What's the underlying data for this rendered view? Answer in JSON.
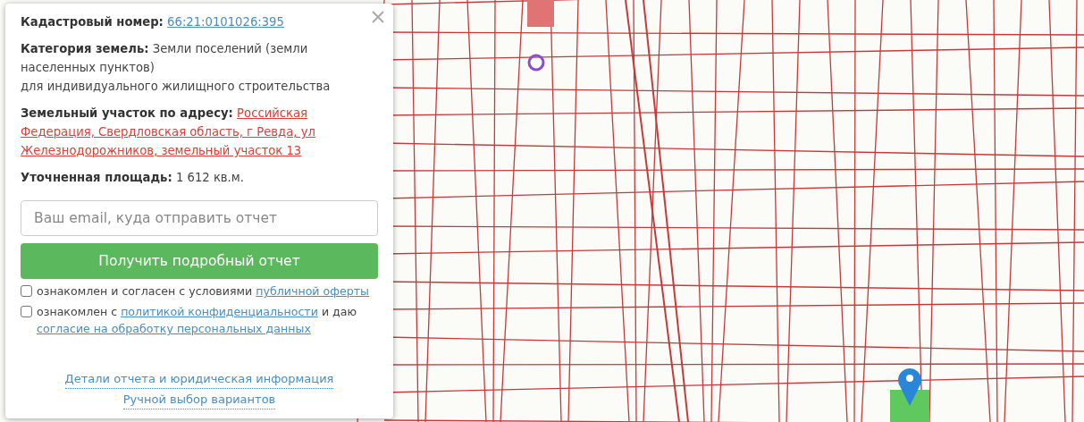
{
  "info_panel": {
    "cadastral": {
      "label": "Кадастровый номер:",
      "value": "66:21:0101026:395"
    },
    "category": {
      "label": "Категория земель:",
      "value": "Земли поселений (земли населенных пунктов)",
      "usage": "для индивидуального жилищного строительства"
    },
    "address": {
      "label": "Земельный участок по адресу:",
      "value_lines": [
        "Российская",
        "Федерация, Свердловская область, г Ревда, ул",
        "Железнодорожников, земельный участок 13"
      ]
    },
    "area": {
      "label": "Уточненная площадь:",
      "value": "1 612 кв.м."
    },
    "email": {
      "placeholder": "Ваш email, куда отправить отчет"
    },
    "submit": "Получить подробный отчет",
    "consents": [
      {
        "checked": false,
        "parts": [
          {
            "kind": "text",
            "text": "ознакомлен и согласен с условиями"
          },
          {
            "kind": "link",
            "text": "публичной оферты"
          }
        ]
      },
      {
        "checked": false,
        "parts": [
          {
            "kind": "text",
            "text": "ознакомлен с"
          },
          {
            "kind": "link",
            "text": "политикой конфиденциальности"
          },
          {
            "kind": "text",
            "text": "и даю"
          },
          {
            "kind": "link",
            "text": "согласие на обработку персональных данных"
          }
        ]
      }
    ],
    "footer_links": [
      "Детали отчета и юридическая информация",
      "Ручной выбор вариантов"
    ]
  }
}
